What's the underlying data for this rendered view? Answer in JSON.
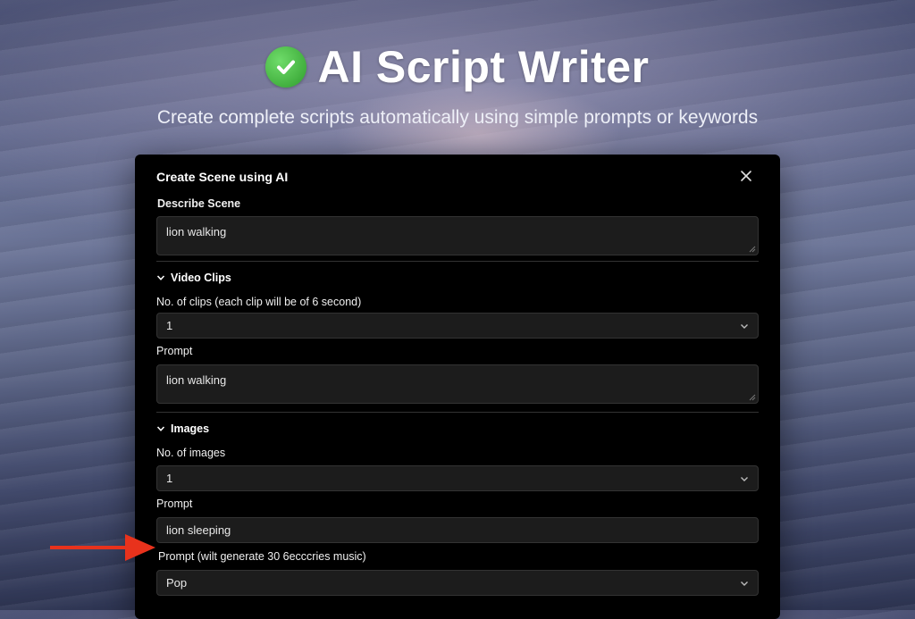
{
  "header": {
    "title": "AI Script Writer",
    "subtitle": "Create complete scripts automatically using simple prompts or keywords"
  },
  "modal": {
    "title": "Create Scene using AI",
    "describe_label": "Describe Scene",
    "describe_value": "lion walking",
    "video_section": "Video Clips",
    "clips_label": "No. of clips (each clip will be of 6 second)",
    "clips_value": "1",
    "video_prompt_label": "Prompt",
    "video_prompt_value": "lion walking",
    "images_section": "Images",
    "images_count_label": "No. of images",
    "images_count_value": "1",
    "image_prompt_label": "Prompt",
    "image_prompt_value": "lion sleeping",
    "music_label": "Prompt (wilt generate 30 6ecccries music)",
    "music_value": "Pop"
  },
  "colors": {
    "accent_check": "#3fb43a",
    "annotation_arrow": "#e8321c"
  }
}
